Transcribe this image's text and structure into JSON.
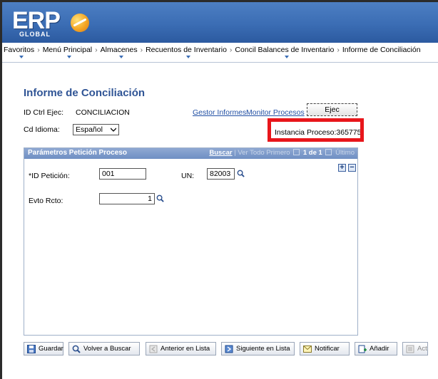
{
  "header": {
    "logo_text": "ERP",
    "logo_subtext": "GLOBAL"
  },
  "breadcrumb": [
    {
      "label": "Favoritos"
    },
    {
      "label": "Menú Principal"
    },
    {
      "label": "Almacenes"
    },
    {
      "label": "Recuentos de Inventario"
    },
    {
      "label": "Concil Balances de Inventario"
    },
    {
      "label": "Informe de Conciliación"
    }
  ],
  "breadcrumb_separator": "›",
  "page": {
    "title": "Informe de Conciliación",
    "id_ctrl_ejec_label": "ID Ctrl Ejec:",
    "id_ctrl_ejec_value": "CONCILIACION",
    "cd_idioma_label": "Cd Idioma:",
    "cd_idioma_value": "Español",
    "gestor_informes": "Gestor Informes",
    "monitor_procesos": "Monitor Procesos",
    "ejec_button": "Ejec",
    "instancia_label": "Instancia Proceso:",
    "instancia_value": "365775",
    "highlight_color": "#e8161b"
  },
  "params": {
    "title": "Parámetros Petición Proceso",
    "buscar": "Buscar",
    "separator": "|",
    "ver_todo": "Ver Todo",
    "primero": "Primero",
    "count": "1 de 1",
    "ultimo": "Último",
    "add": "+",
    "remove": "−",
    "id_peticion_label": "*ID Petición:",
    "id_peticion_value": "001",
    "un_label": "UN:",
    "un_value": "82003",
    "evto_rcto_label": "Evto Rcto:",
    "evto_rcto_value": "1"
  },
  "toolbar": {
    "guardar": "Guardar",
    "volver_a_buscar": "Volver a Buscar",
    "anterior": "Anterior en Lista",
    "siguiente": "Siguiente en Lista",
    "notificar": "Notificar",
    "anadir": "Añadir",
    "actualizar": "Actz/Visualizar"
  },
  "colors": {
    "banner": "#3b6db4",
    "title": "#2f5495",
    "link": "#2250a4",
    "group_header": "#7f9bcb"
  }
}
